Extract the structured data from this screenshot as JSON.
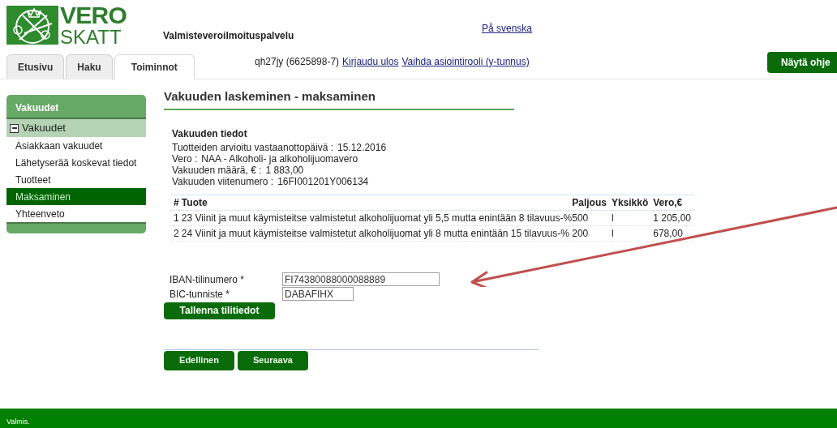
{
  "logo": {
    "line_1": "VERO",
    "line_2": "SKATT"
  },
  "service_title": "Valmisteveroilmoituspalvelu",
  "language_link": "På svenska",
  "tabs": [
    {
      "label": "Etusivu",
      "selected": false
    },
    {
      "label": "Haku",
      "selected": false
    },
    {
      "label": "Toiminnot",
      "selected": true
    }
  ],
  "user": {
    "text": "qh27jy (6625898-7)",
    "links": [
      "Kirjaudu ulos",
      "Vaihda asiointirooli (y-tunnus)"
    ]
  },
  "help_button": "Näytä ohje",
  "sidebar": {
    "title": "Vakuudet",
    "group": {
      "label": "Vakuudet",
      "expanded": true,
      "children": [
        {
          "label": "Asiakkaan vakuudet",
          "selected": false
        },
        {
          "label": "Lähetyserää koskevat tiedot",
          "selected": false
        },
        {
          "label": "Tuotteet",
          "selected": false
        },
        {
          "label": "Maksaminen",
          "selected": true
        },
        {
          "label": "Yhteenveto",
          "selected": false
        }
      ]
    }
  },
  "page_title": "Vakuuden laskeminen - maksaminen",
  "details": {
    "heading": "Vakuuden tiedot",
    "fields": [
      {
        "label": "Tuotteiden arvioitu vastaanottopäivä :",
        "value": "15.12.2016"
      },
      {
        "label": "Vero :",
        "value": "NAA - Alkoholi- ja alkoholijuomavero"
      },
      {
        "label": "Vakuuden määrä, € :",
        "value": "1 883,00"
      },
      {
        "label": "Vakuuden viitenumero :",
        "value": "16FI001201Y006134"
      }
    ]
  },
  "table": {
    "columns": [
      "#",
      "Tuote",
      "Paljous",
      "Yksikkö",
      "Vero,€"
    ],
    "rows": [
      [
        "1",
        "23 Viinit ja muut käymisteitse valmistetut alkoholijuomat yli 5,5 mutta enintään 8 tilavuus-%",
        "500",
        "l",
        "1 205,00"
      ],
      [
        "2",
        "24 Viinit ja muut käymisteitse valmistetut alkoholijuomat yli 8 mutta enintään 15 tilavuus-%",
        "200",
        "l",
        "678,00"
      ]
    ]
  },
  "form": {
    "fields": [
      {
        "label": "IBAN-tilinumero *",
        "value": "FI74380088000088889",
        "kind": "wide"
      },
      {
        "label": "BIC-tunniste *",
        "value": "DABAFIHX",
        "kind": "narrow"
      }
    ],
    "save_button": "Tallenna tilitiedot"
  },
  "nav_buttons": [
    "Edellinen",
    "Seuraava"
  ],
  "status_bar": "Valmis."
}
